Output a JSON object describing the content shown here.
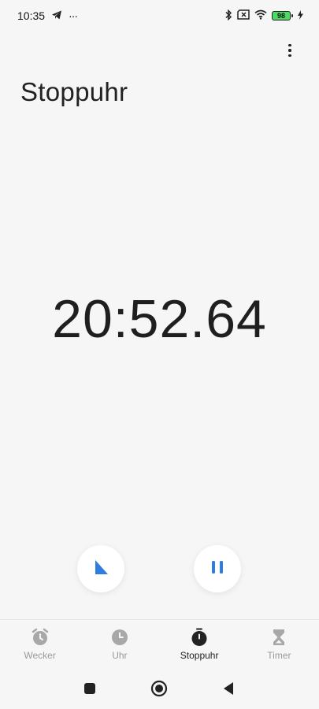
{
  "status_bar": {
    "time": "10:35",
    "more_indicator": "···",
    "battery_level": "98",
    "icons": [
      "telegram-icon",
      "bluetooth-icon",
      "sim-missing-icon",
      "wifi-icon",
      "battery-icon",
      "charging-icon"
    ]
  },
  "header": {
    "title": "Stoppuhr",
    "menu_icon": "more-vert-icon"
  },
  "stopwatch": {
    "display": "20:52.64"
  },
  "controls": {
    "lap_icon": "flag-icon",
    "pause_icon": "pause-icon",
    "accent_color": "#2f7de1"
  },
  "bottom_nav": {
    "tabs": [
      {
        "label": "Wecker",
        "icon": "alarm-icon",
        "active": false
      },
      {
        "label": "Uhr",
        "icon": "clock-icon",
        "active": false
      },
      {
        "label": "Stoppuhr",
        "icon": "stopwatch-icon",
        "active": true
      },
      {
        "label": "Timer",
        "icon": "hourglass-icon",
        "active": false
      }
    ]
  },
  "system_nav": {
    "buttons": [
      "recent-apps-icon",
      "home-icon",
      "back-icon"
    ]
  }
}
